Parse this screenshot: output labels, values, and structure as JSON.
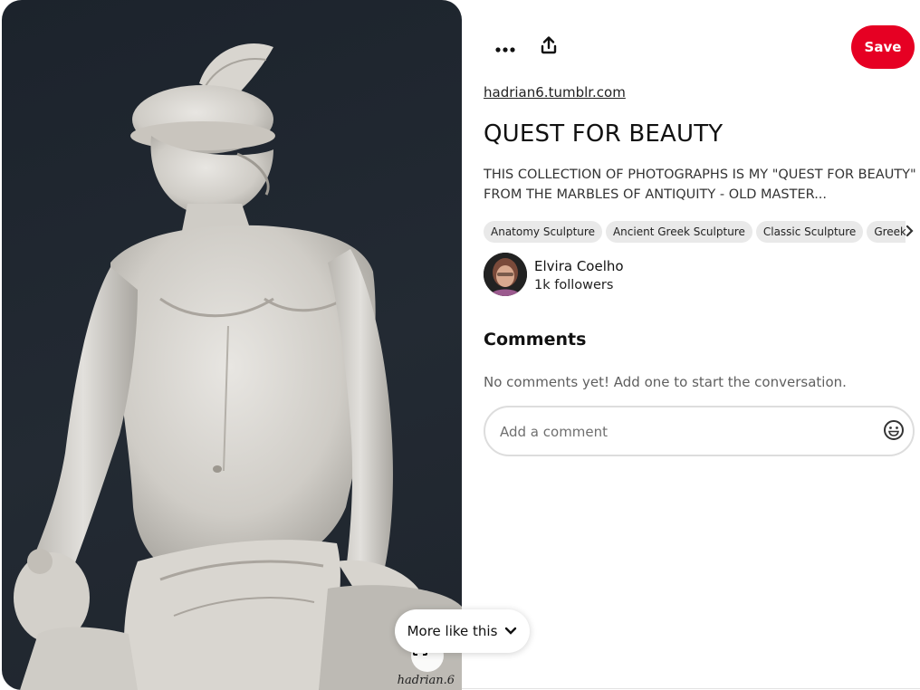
{
  "image": {
    "alt": "",
    "watermark": "hadrian.6"
  },
  "toolbar": {
    "more_icon": "ellipsis-icon",
    "share_icon": "share-icon",
    "save_label": "Save",
    "save_color": "#e60023"
  },
  "pin": {
    "source_link": "hadrian6.tumblr.com",
    "title": "QUEST FOR BEAUTY",
    "description": "THIS COLLECTION OF PHOTOGRAPHS IS MY \"QUEST FOR BEAUTY\" FROM THE MARBLES OF ANTIQUITY - OLD MASTER...",
    "tags": [
      "Anatomy Sculpture",
      "Ancient Greek Sculpture",
      "Classic Sculpture",
      "Greek Statue"
    ]
  },
  "creator": {
    "name": "Elvira Coelho",
    "followers": "1k followers"
  },
  "comments": {
    "heading": "Comments",
    "empty_text": "No comments yet! Add one to start the conversation.",
    "input_placeholder": "Add a comment",
    "emoji_icon": "smiley-icon"
  },
  "more_like_this": {
    "label": "More like this",
    "icon": "chevron-down-icon"
  },
  "visual_search_icon": "visual-search-icon"
}
